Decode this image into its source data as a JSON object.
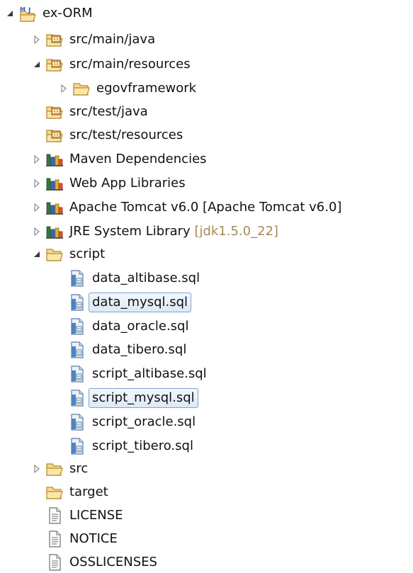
{
  "tree": {
    "project": {
      "label": "ex-ORM",
      "badge": "M",
      "badge2": "J"
    },
    "src_main_java": {
      "label": "src/main/java"
    },
    "src_main_resources": {
      "label": "src/main/resources"
    },
    "egovframework": {
      "label": "egovframework"
    },
    "src_test_java": {
      "label": "src/test/java"
    },
    "src_test_resources": {
      "label": "src/test/resources"
    },
    "maven_dependencies": {
      "label": "Maven Dependencies"
    },
    "web_app_libraries": {
      "label": "Web App Libraries"
    },
    "apache_tomcat": {
      "label": "Apache Tomcat v6.0 [Apache Tomcat v6.0]"
    },
    "jre_system_library": {
      "label": "JRE System Library",
      "decoration": "[jdk1.5.0_22]"
    },
    "script": {
      "label": "script"
    },
    "script_files": [
      {
        "label": "data_altibase.sql"
      },
      {
        "label": "data_mysql.sql"
      },
      {
        "label": "data_oracle.sql"
      },
      {
        "label": "data_tibero.sql"
      },
      {
        "label": "script_altibase.sql"
      },
      {
        "label": "script_mysql.sql"
      },
      {
        "label": "script_oracle.sql"
      },
      {
        "label": "script_tibero.sql"
      }
    ],
    "src": {
      "label": "src"
    },
    "target": {
      "label": "target"
    },
    "license": {
      "label": "LICENSE"
    },
    "notice": {
      "label": "NOTICE"
    },
    "osslicenses": {
      "label": "OSSLICENSES"
    }
  },
  "colors": {
    "selection_border": "#7da2ce",
    "folder": "#e7b95a",
    "decoration_text": "#a5895a"
  },
  "icons": {
    "expanded": "expanded-arrow-icon",
    "collapsed": "collapsed-arrow-icon",
    "project": "maven-project-icon",
    "source_folder": "source-folder-icon",
    "folder": "folder-icon",
    "library": "library-icon",
    "sql_file": "sql-file-icon",
    "text_file": "text-file-icon"
  }
}
